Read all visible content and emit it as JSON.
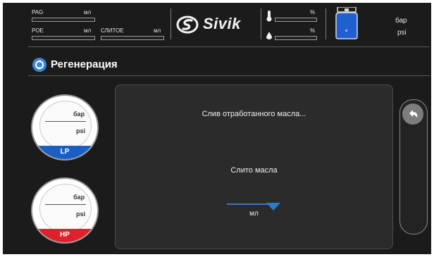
{
  "header": {
    "oil_left": [
      {
        "name": "PAG",
        "unit": "мл"
      },
      {
        "name": "POE",
        "unit": "мл"
      }
    ],
    "oil_drain": {
      "name": "СЛИТОЕ",
      "unit": "мл"
    },
    "logo_text": "Sivik",
    "levels": [
      {
        "icon": "thermometer-icon",
        "unit": "%"
      },
      {
        "icon": "drop-icon",
        "unit": "%"
      }
    ],
    "tank": {
      "label": "кг",
      "pressure_unit": "бар",
      "pressure_unit_alt": "psi"
    }
  },
  "title": {
    "text": "Регенерация",
    "icon": "recycle-icon"
  },
  "gauges": {
    "lp": {
      "unit_top": "бар",
      "unit_bottom": "psi",
      "label": "LP",
      "color": "#1a5fc4"
    },
    "hp": {
      "unit_top": "бар",
      "unit_bottom": "psi",
      "label": "HP",
      "color": "#e0202a"
    }
  },
  "panel": {
    "status": "Слив отработанного масла...",
    "drained_label": "Слито масла",
    "drained_unit": "мл"
  },
  "side": {
    "back_icon": "back-arrow-icon"
  }
}
